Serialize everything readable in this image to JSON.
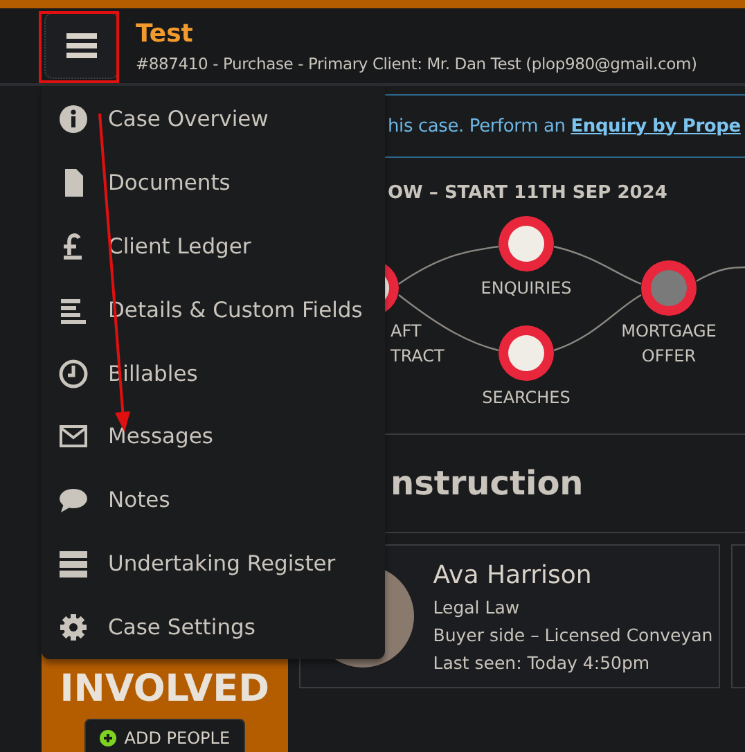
{
  "header": {
    "title": "Test",
    "subtitle": "#887410 - Purchase - Primary Client: Mr. Dan Test (plop980@gmail.com)"
  },
  "menu": {
    "items": [
      "Case Overview",
      "Documents",
      "Client Ledger",
      "Details & Custom Fields",
      "Billables",
      "Messages",
      "Notes",
      "Undertaking Register",
      "Case Settings"
    ]
  },
  "notice": {
    "text": "his case. Perform an ",
    "link": "Enquiry by Prope"
  },
  "workflow": {
    "title": "OW – START 11TH SEP 2024",
    "steps": [
      {
        "lines": [
          "AFT",
          "TRACT"
        ]
      },
      {
        "lines": [
          "ENQUIRIES"
        ]
      },
      {
        "lines": [
          "SEARCHES"
        ]
      },
      {
        "lines": [
          "MORTGAGE",
          "OFFER"
        ]
      }
    ]
  },
  "next_task": {
    "title": "nstruction"
  },
  "people": {
    "panel_title": "INVOLVED",
    "add_button": "ADD PEOPLE",
    "card": {
      "name": "Ava Harrison",
      "company": "Legal Law",
      "role": "Buyer side – Licensed Conveyan",
      "last_seen": "Last seen: Today 4:50pm"
    }
  }
}
